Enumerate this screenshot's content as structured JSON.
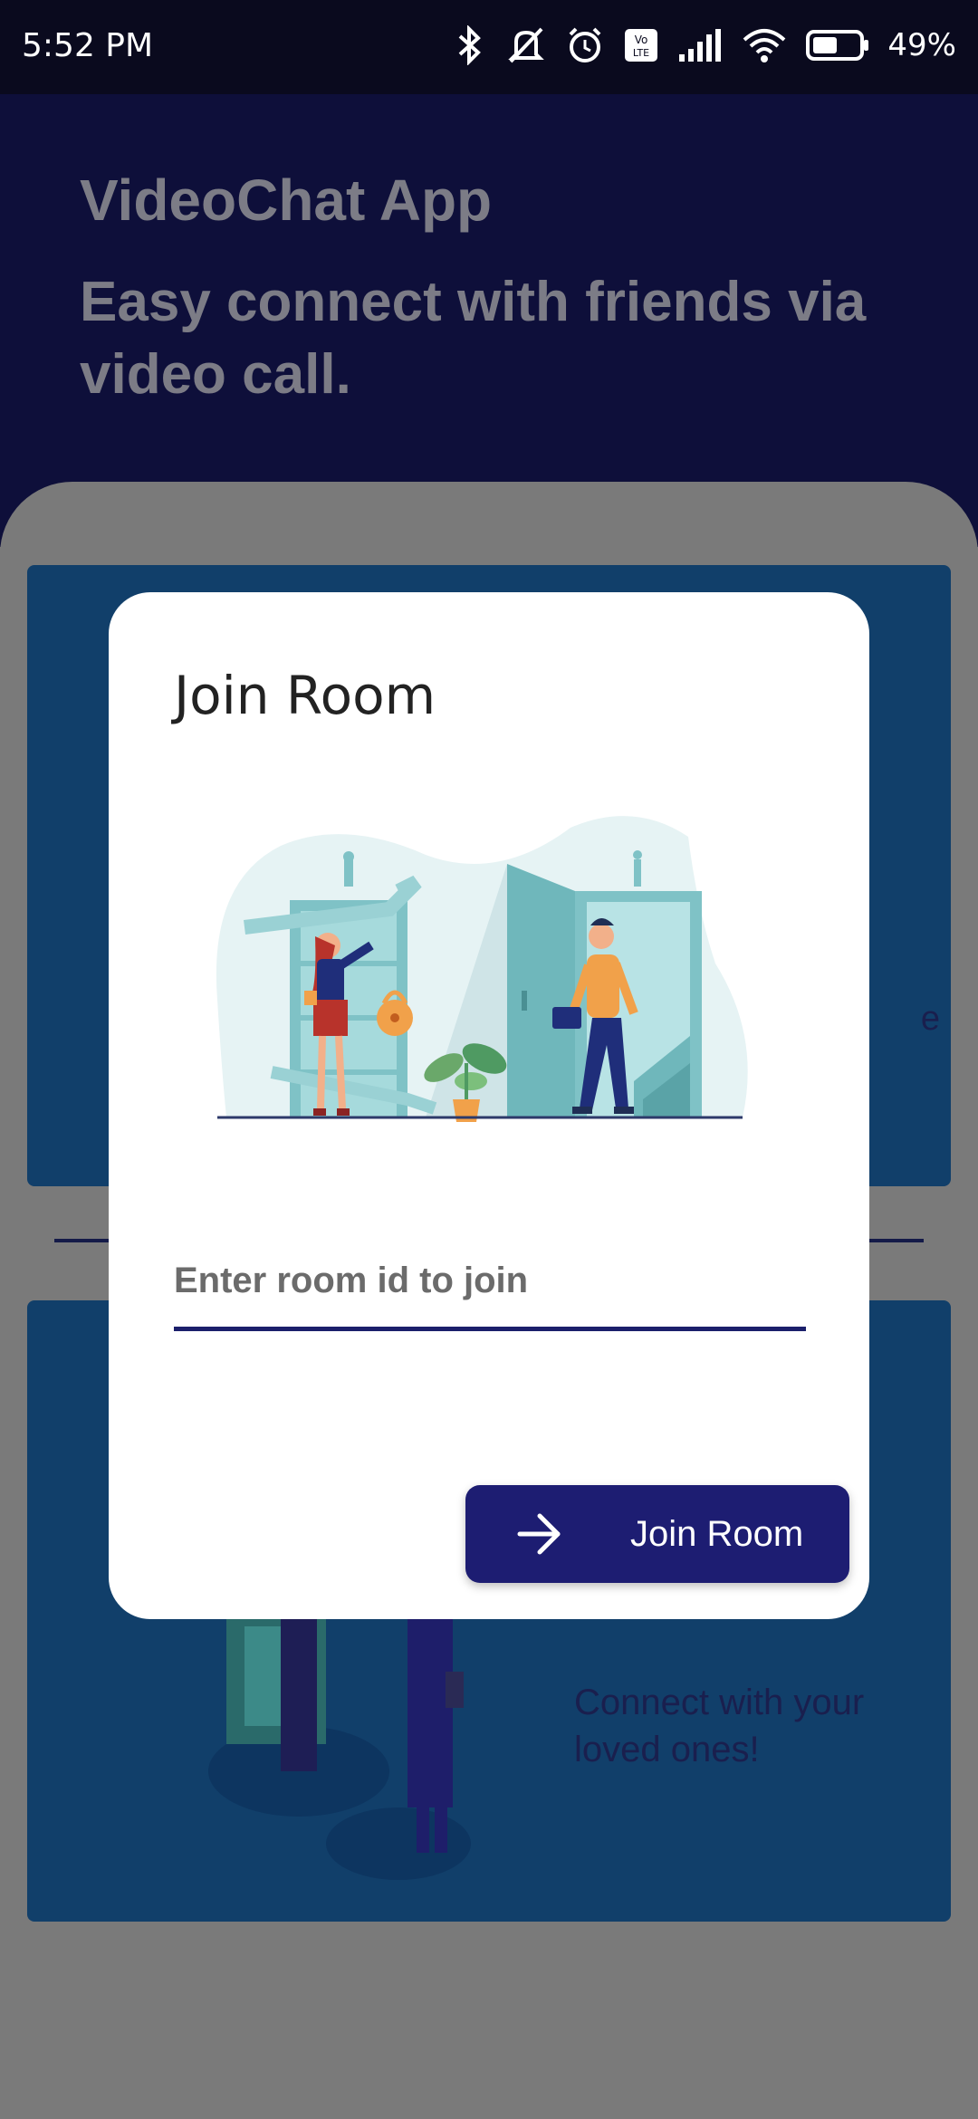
{
  "status_bar": {
    "time": "5:52 PM",
    "battery_percent": "49%",
    "icons": [
      "bluetooth-icon",
      "mute-icon",
      "alarm-icon",
      "volte-icon",
      "signal-icon",
      "wifi-icon",
      "battery-icon"
    ]
  },
  "header": {
    "app_title": "VideoChat App",
    "tagline": "Easy connect with friends via video call."
  },
  "background_cards": {
    "card1_peek_text": "e",
    "card2_caption": "Connect with your loved ones!"
  },
  "dialog": {
    "title": "Join Room",
    "input_placeholder": "Enter room id to join",
    "input_value": "",
    "button_label": "Join Room",
    "button_icon": "arrow-right-icon"
  },
  "colors": {
    "primary": "#1d1d72",
    "header_bg": "#0e0f3a",
    "card_bg": "#113f6a",
    "scrim": "#7a7a7a"
  }
}
